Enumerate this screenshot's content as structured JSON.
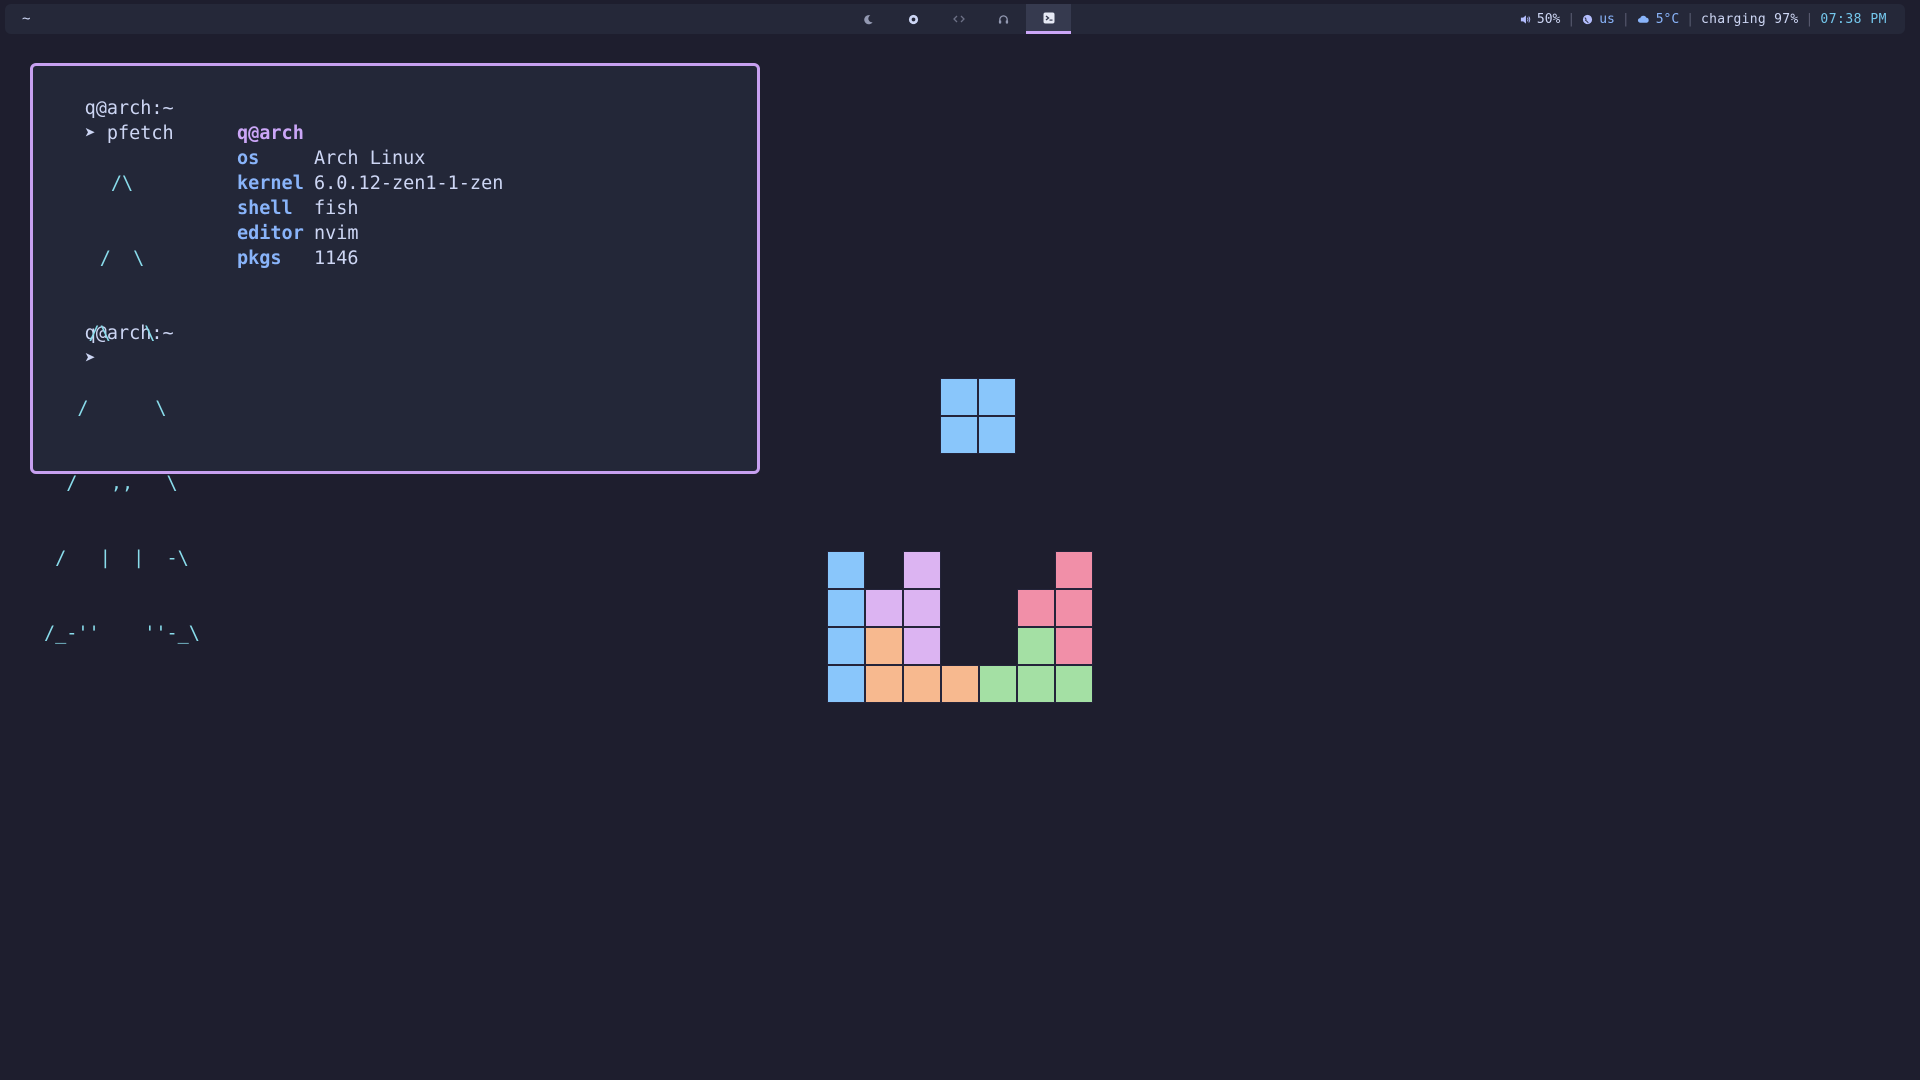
{
  "topbar": {
    "left_label": "~",
    "workspaces": [
      {
        "icon": "moon-icon",
        "active": false
      },
      {
        "icon": "record-icon",
        "active": false
      },
      {
        "icon": "code-icon",
        "active": false
      },
      {
        "icon": "headphones-icon",
        "active": false
      },
      {
        "icon": "terminal-icon",
        "active": true
      }
    ],
    "volume": "50%",
    "keyboard_layout": "us",
    "weather": "5°C",
    "battery": "charging 97%",
    "clock": "07:38 PM",
    "separator": "|"
  },
  "terminal": {
    "prompt_user": "q@arch",
    "prompt_path": ":~",
    "prompt_arrow": "➤",
    "command": "pfetch",
    "ascii_logo": [
      "      /\\",
      "     /  \\",
      "    /\\   \\",
      "   /      \\",
      "  /   ,,   \\",
      " /   |  |  -\\",
      "/_-''    ''-_\\"
    ],
    "fetch": {
      "host": "q@arch",
      "rows": [
        {
          "key": "os",
          "value": "Arch Linux"
        },
        {
          "key": "kernel",
          "value": "6.0.12-zen1-1-zen"
        },
        {
          "key": "shell",
          "value": "fish"
        },
        {
          "key": "editor",
          "value": "nvim"
        },
        {
          "key": "pkgs",
          "value": "1146"
        }
      ]
    }
  },
  "colors": {
    "background": "#1e1e2e",
    "bar": "#252839",
    "terminal_border": "#c7a0f0",
    "block_blue": "#89c6fb",
    "block_purple": "#dcb4f2",
    "block_orange": "#f7b98f",
    "block_green": "#a4e0a4",
    "block_pink": "#f18fa8"
  }
}
